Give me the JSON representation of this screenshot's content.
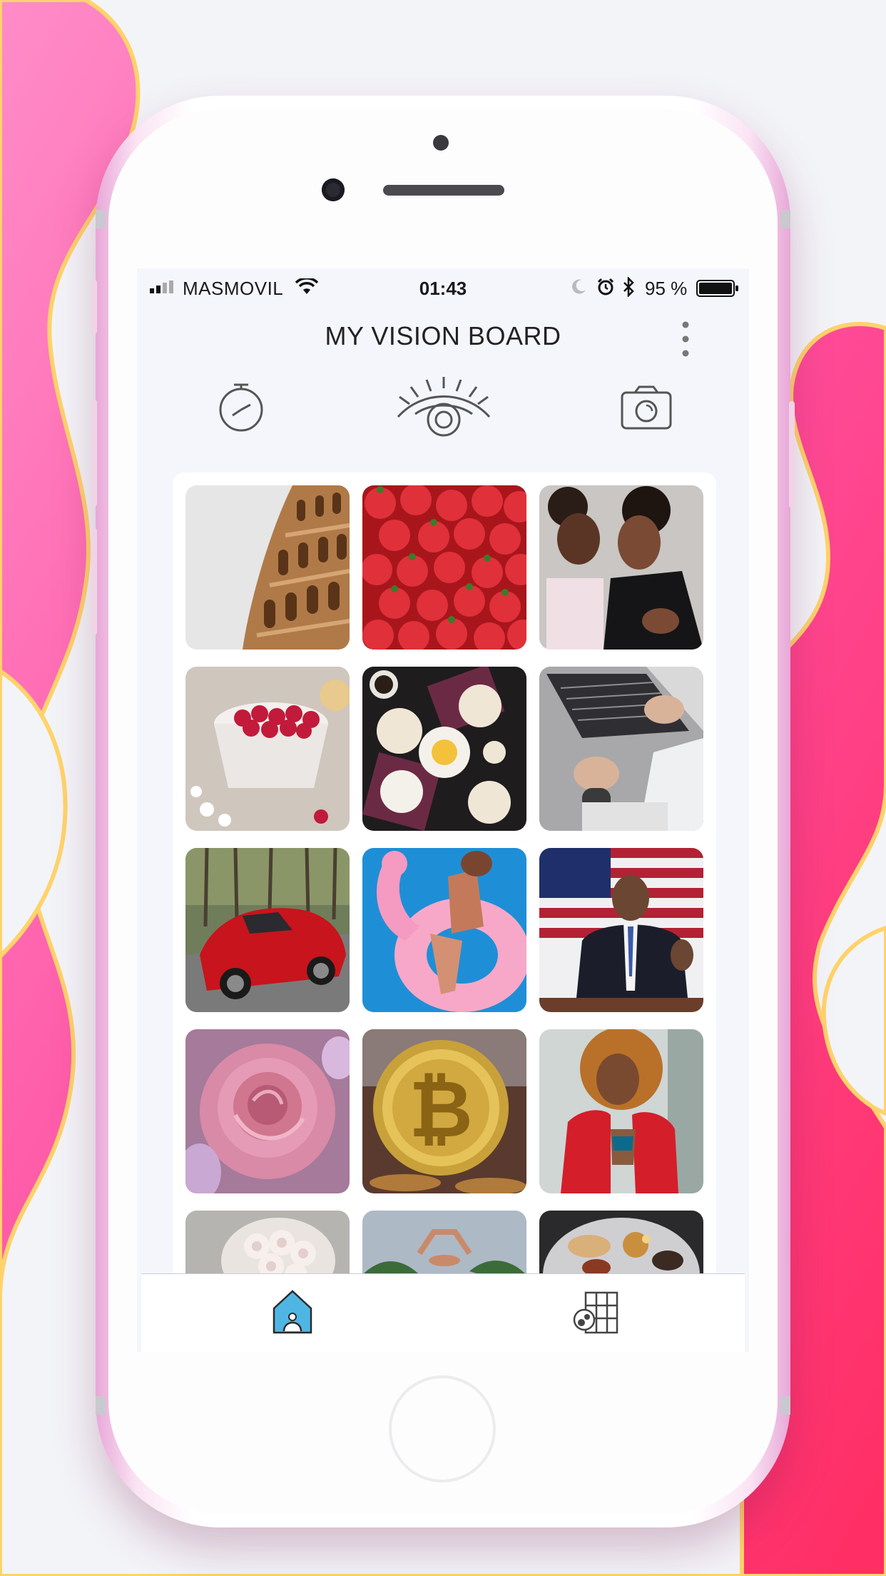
{
  "status_bar": {
    "carrier": "MASMOVIL",
    "time": "01:43",
    "battery": "95 %"
  },
  "header": {
    "title": "MY VISION BOARD"
  },
  "toolbar": {
    "icons": [
      "alarm-clock-icon",
      "eye-icon",
      "camera-icon"
    ]
  },
  "board": {
    "images": [
      "colosseum",
      "strawberries",
      "mother-and-daughter-kiss",
      "raspberries-bowl",
      "breakfast-table",
      "laptop-typing",
      "red-sports-car",
      "pink-flamingo-float",
      "president-speech",
      "pink-rose",
      "bitcoin-coin",
      "woman-red-jacket",
      "white-roses-bouquet",
      "beach-sky",
      "food-platter"
    ]
  },
  "tab_bar": {
    "tabs": [
      "home-icon",
      "vision-grid-icon"
    ],
    "active": "home-icon"
  },
  "colors": {
    "accent": "#4fb6e4",
    "background_pink": "#ff3d7f",
    "screen_bg": "#f4f6fc"
  }
}
